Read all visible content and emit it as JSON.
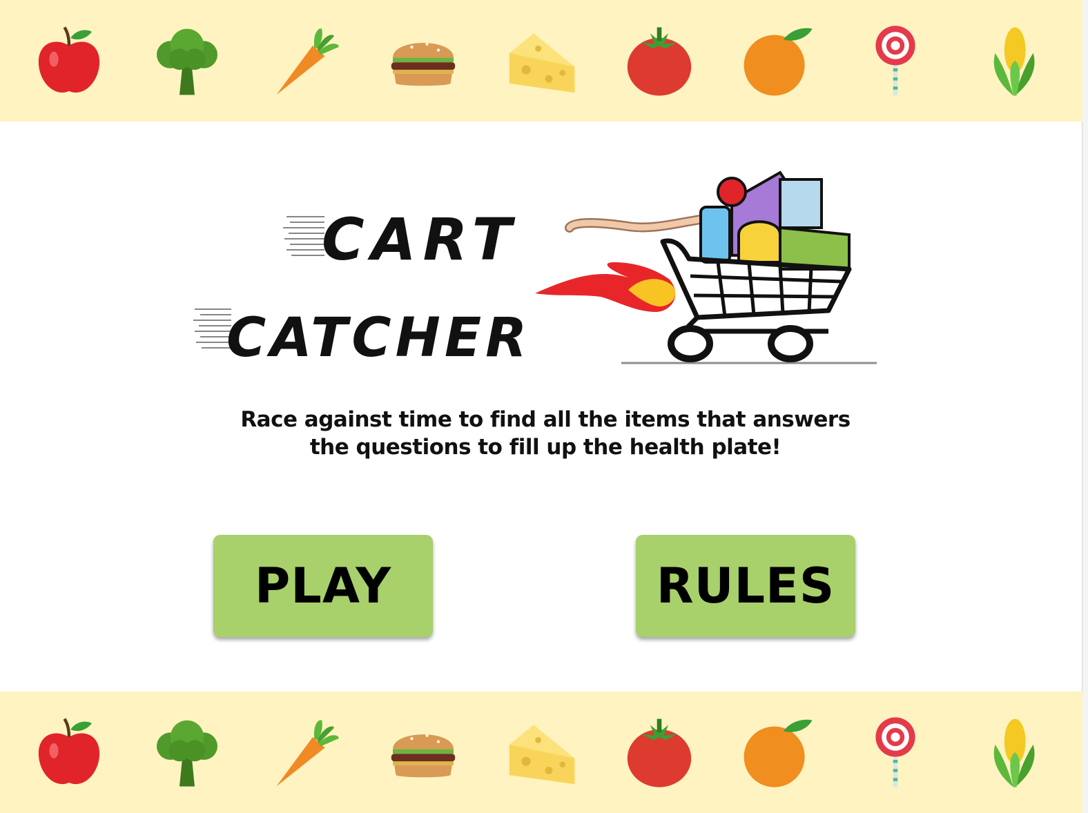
{
  "logo": {
    "line1": "CART",
    "line2": "CATCHER"
  },
  "tagline": {
    "line1": "Race against time to find all the items that answers",
    "line2": "the questions to fill up the health plate!"
  },
  "buttons": {
    "play_label": "PLAY",
    "rules_label": "RULES"
  },
  "banner_icons": [
    "apple-icon",
    "broccoli-icon",
    "carrot-icon",
    "burger-icon",
    "cheese-icon",
    "tomato-icon",
    "orange-icon",
    "lollipop-icon",
    "corn-icon"
  ],
  "colors": {
    "banner": "#fff3c2",
    "button": "#a8d06b",
    "text": "#111111"
  }
}
